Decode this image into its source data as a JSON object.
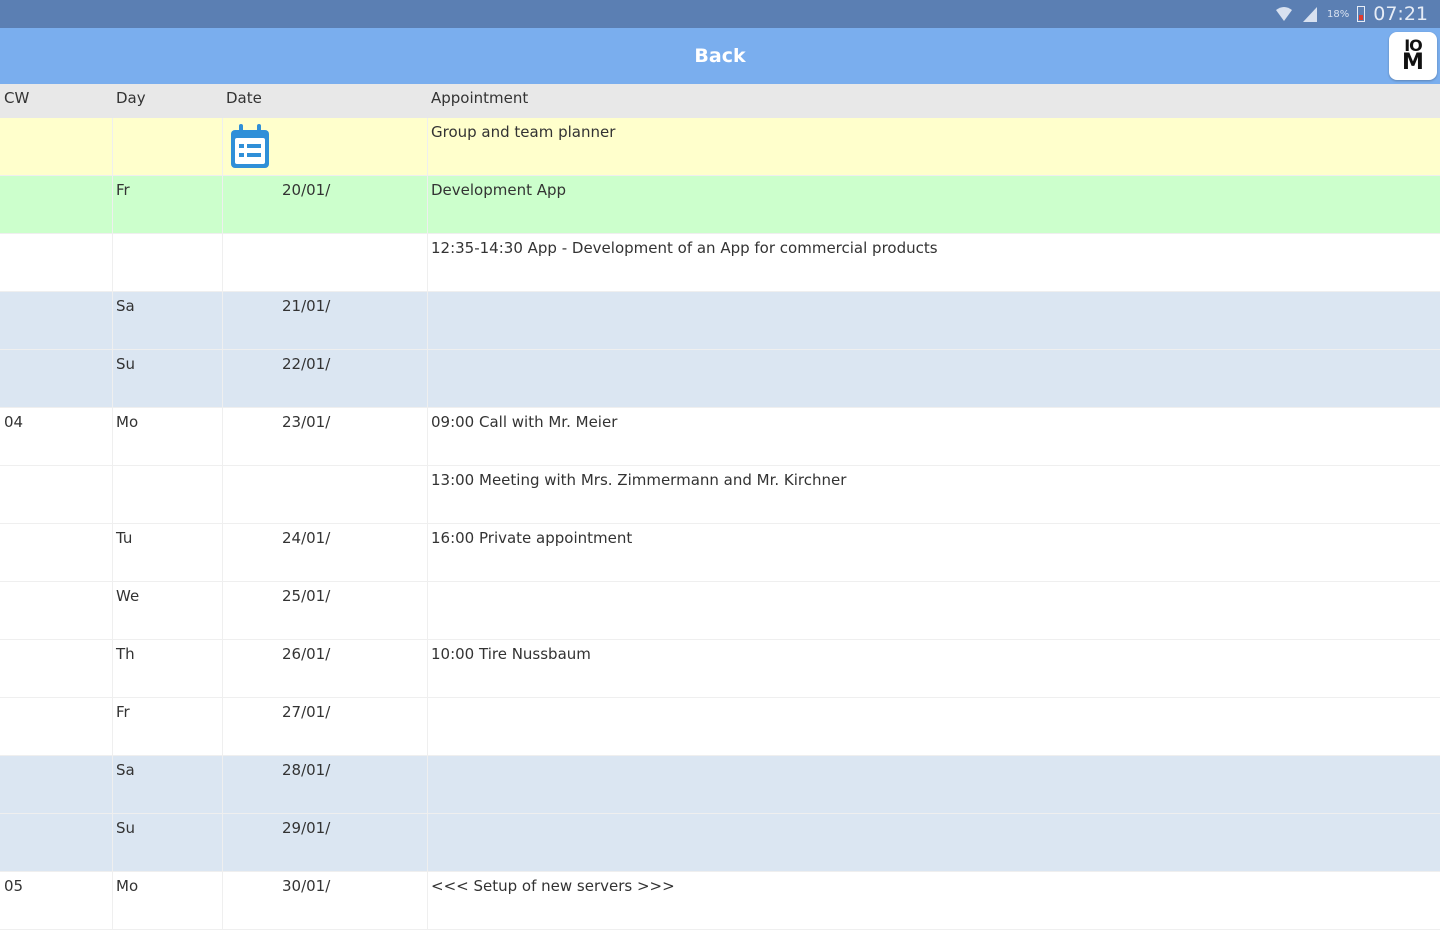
{
  "status_bar": {
    "battery": "18%",
    "time": "07:21",
    "icons": [
      "wifi-icon",
      "signal-icon",
      "battery-icon"
    ],
    "background": "#5b7fb3"
  },
  "app_bar": {
    "back_label": "Back",
    "logo_line1": "IO",
    "logo_line2": "M",
    "background": "#7aaeee"
  },
  "table": {
    "headers": {
      "cw": "CW",
      "day": "Day",
      "date": "Date",
      "appointment": "Appointment"
    },
    "rows": [
      {
        "cw": "",
        "day": "",
        "date": "",
        "appointment": "Group and team planner",
        "bg": "yellow",
        "icon": "calendar-icon"
      },
      {
        "cw": "",
        "day": "Fr",
        "date": "20/01/",
        "appointment": "Development App",
        "bg": "green"
      },
      {
        "cw": "",
        "day": "",
        "date": "",
        "appointment": "12:35-14:30 App - Development of an App for commercial products",
        "bg": "white"
      },
      {
        "cw": "",
        "day": "Sa",
        "date": "21/01/",
        "appointment": "",
        "bg": "blue"
      },
      {
        "cw": "",
        "day": "Su",
        "date": "22/01/",
        "appointment": "",
        "bg": "blue"
      },
      {
        "cw": "04",
        "day": "Mo",
        "date": "23/01/",
        "appointment": "09:00 Call with Mr. Meier",
        "bg": "white"
      },
      {
        "cw": "",
        "day": "",
        "date": "",
        "appointment": "13:00 Meeting with Mrs. Zimmermann and Mr. Kirchner",
        "bg": "white"
      },
      {
        "cw": "",
        "day": "Tu",
        "date": "24/01/",
        "appointment": "16:00 Private appointment",
        "bg": "white"
      },
      {
        "cw": "",
        "day": "We",
        "date": "25/01/",
        "appointment": "",
        "bg": "white"
      },
      {
        "cw": "",
        "day": "Th",
        "date": "26/01/",
        "appointment": "10:00 Tire Nussbaum",
        "bg": "white"
      },
      {
        "cw": "",
        "day": "Fr",
        "date": "27/01/",
        "appointment": "",
        "bg": "white"
      },
      {
        "cw": "",
        "day": "Sa",
        "date": "28/01/",
        "appointment": "",
        "bg": "blue"
      },
      {
        "cw": "",
        "day": "Su",
        "date": "29/01/",
        "appointment": "",
        "bg": "blue"
      },
      {
        "cw": "05",
        "day": "Mo",
        "date": "30/01/",
        "appointment": "<<< Setup of new servers >>>",
        "bg": "white"
      }
    ]
  },
  "colors": {
    "yellow_row": "#ffffcc",
    "green_row": "#ccffcc",
    "weekend_row": "#dbe6f2",
    "header_bg": "#e8e8e8",
    "calendar_icon": "#2f8fd8"
  }
}
